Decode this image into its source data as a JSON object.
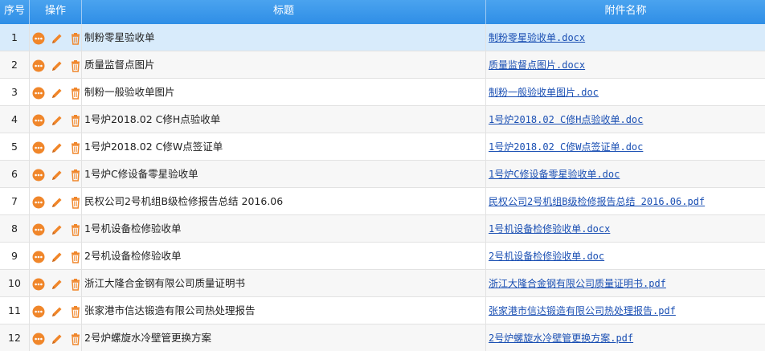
{
  "colors": {
    "header_bg": "#3a98ea",
    "selected_row": "#d8ebfb",
    "link": "#1a4fb3",
    "icon_orange": "#f0862a"
  },
  "icons": {
    "more": "more-dots-icon",
    "edit": "pencil-icon",
    "delete": "trash-icon"
  },
  "header": {
    "seq": "序号",
    "ops": "操作",
    "title": "标题",
    "attachment": "附件名称"
  },
  "rows": [
    {
      "seq": "1",
      "title": "制粉零星验收单",
      "attachment": "制粉零星验收单.docx"
    },
    {
      "seq": "2",
      "title": "质量监督点图片",
      "attachment": "质量监督点图片.docx"
    },
    {
      "seq": "3",
      "title": "制粉一般验收单图片",
      "attachment": "制粉一般验收单图片.doc"
    },
    {
      "seq": "4",
      "title": "1号炉2018.02 C修H点验收单",
      "attachment": "1号炉2018.02 C修H点验收单.doc"
    },
    {
      "seq": "5",
      "title": "1号炉2018.02 C修W点签证单",
      "attachment": "1号炉2018.02 C修W点签证单.doc"
    },
    {
      "seq": "6",
      "title": "1号炉C修设备零星验收单",
      "attachment": "1号炉C修设备零星验收单.doc"
    },
    {
      "seq": "7",
      "title": "民权公司2号机组B级检修报告总结 2016.06",
      "attachment": "民权公司2号机组B级检修报告总结 2016.06.pdf"
    },
    {
      "seq": "8",
      "title": "1号机设备检修验收单",
      "attachment": "1号机设备检修验收单.docx"
    },
    {
      "seq": "9",
      "title": "2号机设备检修验收单",
      "attachment": "2号机设备检修验收单.doc"
    },
    {
      "seq": "10",
      "title": "浙江大隆合金钢有限公司质量证明书",
      "attachment": "浙江大隆合金钢有限公司质量证明书.pdf"
    },
    {
      "seq": "11",
      "title": "张家港市信达锻造有限公司热处理报告",
      "attachment": "张家港市信达锻造有限公司热处理报告.pdf"
    },
    {
      "seq": "12",
      "title": "2号炉螺旋水冷壁管更换方案",
      "attachment": "2号炉螺旋水冷壁管更换方案.pdf"
    }
  ]
}
